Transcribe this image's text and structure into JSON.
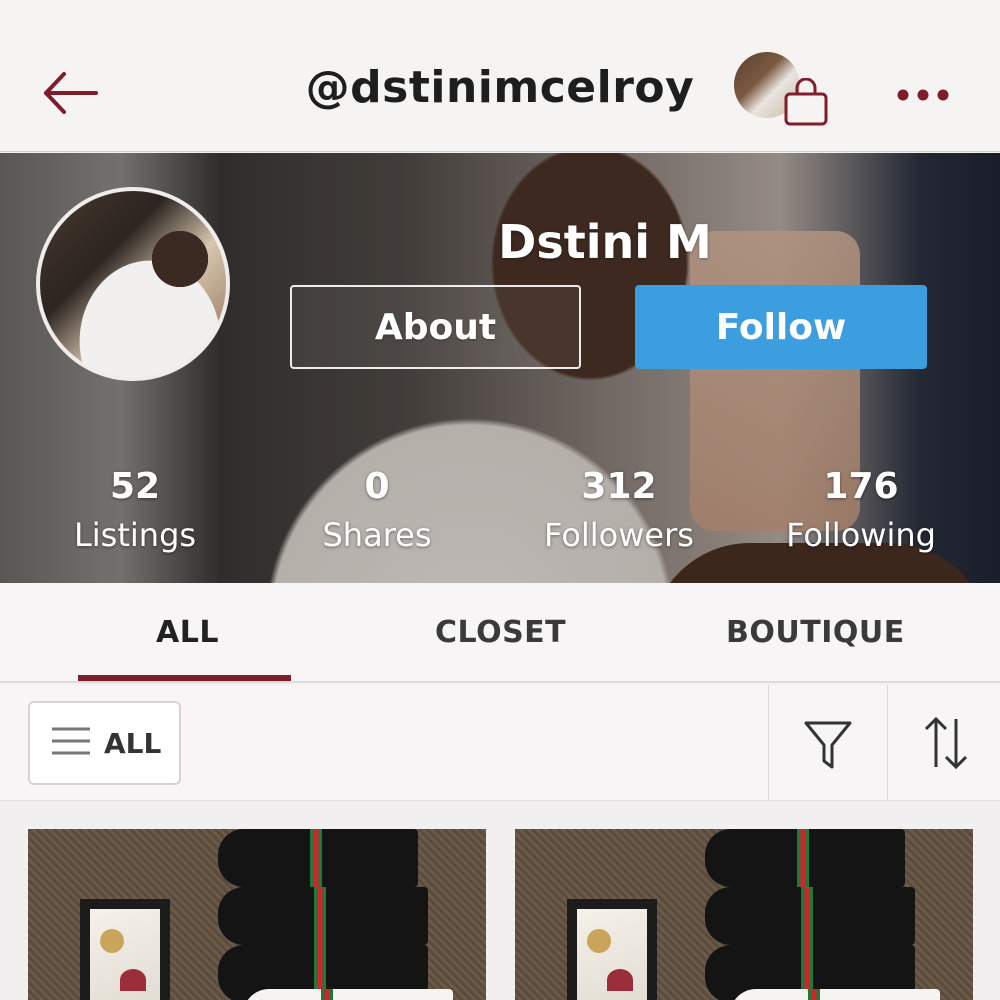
{
  "header": {
    "handle": "@dstinimcelroy",
    "back_icon": "back-arrow-icon",
    "bag_icon": "shopping-bag-icon",
    "more_icon": "more-dots-icon",
    "accent_color": "#7f1d2c"
  },
  "profile": {
    "display_name": "Dstini M",
    "about_label": "About",
    "follow_label": "Follow",
    "follow_color": "#3c9ede"
  },
  "stats": [
    {
      "value": "52",
      "label": "Listings"
    },
    {
      "value": "0",
      "label": "Shares"
    },
    {
      "value": "312",
      "label": "Followers"
    },
    {
      "value": "176",
      "label": "Following"
    }
  ],
  "tabs": [
    {
      "label": "ALL",
      "active": true
    },
    {
      "label": "CLOSET",
      "active": false
    },
    {
      "label": "BOUTIQUE",
      "active": false
    }
  ],
  "filterbar": {
    "category_label": "ALL",
    "category_icon": "menu-lines-icon",
    "filter_icon": "filter-funnel-icon",
    "sort_icon": "sort-arrows-icon"
  }
}
